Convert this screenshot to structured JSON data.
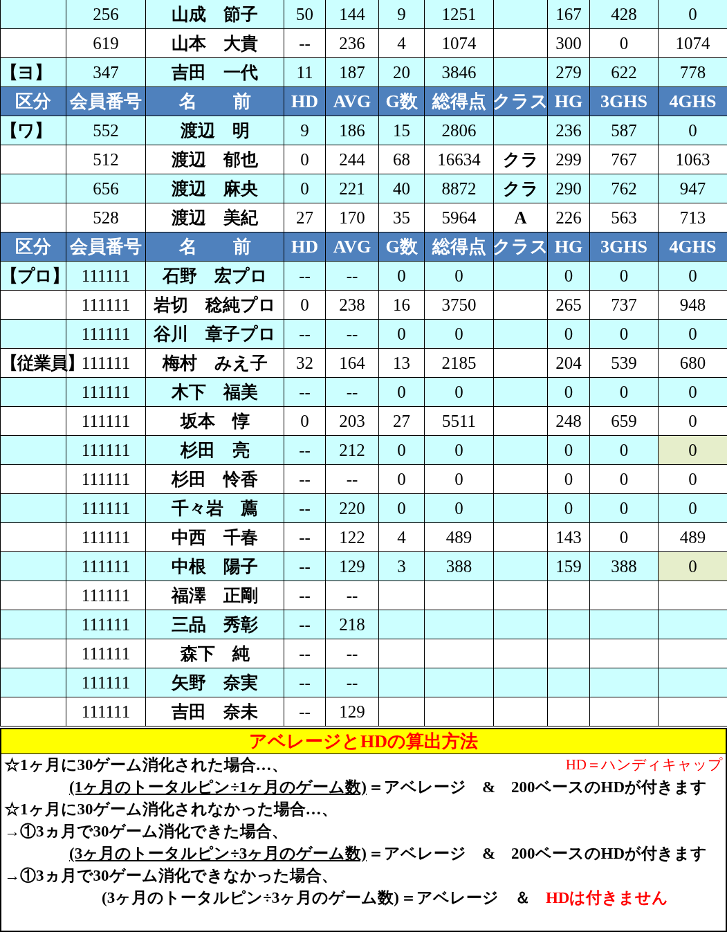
{
  "rows": [
    {
      "kind": "member",
      "shaded": true,
      "member_no": "256",
      "name": "山成　節子",
      "hd": "50",
      "avg": "144",
      "games": "9",
      "total": "1251",
      "hg": "167",
      "ghs3": "428",
      "ghs4": "0",
      "ghs4_flagged": false
    },
    {
      "kind": "member",
      "shaded": false,
      "member_no": "619",
      "name": "山本　大貴",
      "hd": "--",
      "avg": "236",
      "games": "4",
      "total": "1074",
      "hg": "300",
      "ghs3": "0",
      "ghs4": "1074",
      "ghs4_flagged": false
    },
    {
      "kind": "member",
      "shaded": true,
      "group": "【ヨ】",
      "member_no": "347",
      "name": "吉田　一代",
      "hd": "11",
      "avg": "187",
      "games": "20",
      "total": "3846",
      "hg": "279",
      "ghs3": "622",
      "ghs4": "778",
      "ghs4_flagged": false
    },
    {
      "kind": "header",
      "cells": [
        "区分",
        "会員番号",
        "名　　前",
        "HD",
        "AVG",
        "G数",
        "総得点",
        "クラス",
        "HG",
        "3GHS",
        "4GHS"
      ]
    },
    {
      "kind": "member",
      "shaded": true,
      "group": "【ワ】",
      "member_no": "552",
      "name": "渡辺　明",
      "hd": "9",
      "avg": "186",
      "games": "15",
      "total": "2806",
      "hg": "236",
      "ghs3": "587",
      "ghs4": "0",
      "ghs4_flagged": false
    },
    {
      "kind": "member",
      "shaded": false,
      "member_no": "512",
      "name": "渡辺　郁也",
      "hd": "0",
      "avg": "244",
      "games": "68",
      "total": "16634",
      "class": "クラ",
      "hg": "299",
      "ghs3": "767",
      "ghs4": "1063",
      "ghs4_flagged": false
    },
    {
      "kind": "member",
      "shaded": true,
      "member_no": "656",
      "name": "渡辺　麻央",
      "hd": "0",
      "avg": "221",
      "games": "40",
      "total": "8872",
      "class": "クラ",
      "hg": "290",
      "ghs3": "762",
      "ghs4": "947",
      "ghs4_flagged": false
    },
    {
      "kind": "member",
      "shaded": false,
      "member_no": "528",
      "name": "渡辺　美紀",
      "hd": "27",
      "avg": "170",
      "games": "35",
      "total": "5964",
      "class": "A",
      "hg": "226",
      "ghs3": "563",
      "ghs4": "713",
      "ghs4_flagged": false
    },
    {
      "kind": "header",
      "cells": [
        "区分",
        "会員番号",
        "名　　前",
        "HD",
        "AVG",
        "G数",
        "総得点",
        "クラス",
        "HG",
        "3GHS",
        "4GHS"
      ]
    },
    {
      "kind": "member",
      "shaded": true,
      "group": "【プロ】",
      "member_no": "111111",
      "name": "石野　宏プロ",
      "hd": "--",
      "avg": "--",
      "games": "0",
      "total": "0",
      "hg": "0",
      "ghs3": "0",
      "ghs4": "0",
      "ghs4_flagged": false
    },
    {
      "kind": "member",
      "shaded": false,
      "member_no": "111111",
      "name": "岩切　稔純プロ",
      "hd": "0",
      "avg": "238",
      "games": "16",
      "total": "3750",
      "hg": "265",
      "ghs3": "737",
      "ghs4": "948",
      "ghs4_flagged": false
    },
    {
      "kind": "member",
      "shaded": true,
      "member_no": "111111",
      "name": "谷川　章子プロ",
      "hd": "--",
      "avg": "--",
      "games": "0",
      "total": "0",
      "hg": "0",
      "ghs3": "0",
      "ghs4": "0",
      "ghs4_flagged": false
    },
    {
      "kind": "member",
      "shaded": false,
      "group": "【従業員】",
      "member_no": "111111",
      "name": "梅村　みえ子",
      "hd": "32",
      "avg": "164",
      "games": "13",
      "total": "2185",
      "hg": "204",
      "ghs3": "539",
      "ghs4": "680",
      "ghs4_flagged": false
    },
    {
      "kind": "member",
      "shaded": true,
      "member_no": "111111",
      "name": "木下　福美",
      "hd": "--",
      "avg": "--",
      "games": "0",
      "total": "0",
      "hg": "0",
      "ghs3": "0",
      "ghs4": "0",
      "ghs4_flagged": false
    },
    {
      "kind": "member",
      "shaded": false,
      "member_no": "111111",
      "name": "坂本　惇",
      "hd": "0",
      "avg": "203",
      "games": "27",
      "total": "5511",
      "hg": "248",
      "ghs3": "659",
      "ghs4": "0",
      "ghs4_flagged": false
    },
    {
      "kind": "member",
      "shaded": true,
      "member_no": "111111",
      "name": "杉田　亮",
      "hd": "--",
      "avg": "212",
      "games": "0",
      "total": "0",
      "hg": "0",
      "ghs3": "0",
      "ghs4": "0",
      "ghs4_flagged": true
    },
    {
      "kind": "member",
      "shaded": false,
      "member_no": "111111",
      "name": "杉田　怜香",
      "hd": "--",
      "avg": "--",
      "games": "0",
      "total": "0",
      "hg": "0",
      "ghs3": "0",
      "ghs4": "0",
      "ghs4_flagged": false
    },
    {
      "kind": "member",
      "shaded": true,
      "member_no": "111111",
      "name": "千々岩　薦",
      "hd": "--",
      "avg": "220",
      "games": "0",
      "total": "0",
      "hg": "0",
      "ghs3": "0",
      "ghs4": "0",
      "ghs4_flagged": false
    },
    {
      "kind": "member",
      "shaded": false,
      "member_no": "111111",
      "name": "中西　千春",
      "hd": "--",
      "avg": "122",
      "games": "4",
      "total": "489",
      "hg": "143",
      "ghs3": "0",
      "ghs4": "489",
      "ghs4_flagged": false
    },
    {
      "kind": "member",
      "shaded": true,
      "member_no": "111111",
      "name": "中根　陽子",
      "hd": "--",
      "avg": "129",
      "games": "3",
      "total": "388",
      "hg": "159",
      "ghs3": "388",
      "ghs4": "0",
      "ghs4_flagged": true
    },
    {
      "kind": "member",
      "shaded": false,
      "member_no": "111111",
      "name": "福澤　正剛",
      "hd": "--",
      "avg": "--"
    },
    {
      "kind": "member",
      "shaded": true,
      "member_no": "111111",
      "name": "三品　秀彰",
      "hd": "--",
      "avg": "218"
    },
    {
      "kind": "member",
      "shaded": false,
      "member_no": "111111",
      "name": "森下　純",
      "hd": "--",
      "avg": "--"
    },
    {
      "kind": "member",
      "shaded": true,
      "member_no": "111111",
      "name": "矢野　奈実",
      "hd": "--",
      "avg": "--"
    },
    {
      "kind": "member",
      "shaded": false,
      "member_no": "111111",
      "name": "吉田　奈未",
      "hd": "--",
      "avg": "129"
    }
  ],
  "note": {
    "title": "アベレージとHDの算出方法",
    "aside": "HD＝ハンディキャップ",
    "lines": [
      {
        "kind": "heading",
        "text": "☆1ヶ月に30ゲーム消化された場合…、"
      },
      {
        "kind": "formula",
        "formula": "(1ヶ月のトータルピン÷1ヶ月のゲーム数)",
        "underlined": true,
        "result": "＝アベレージ　&　200ベースのHDが付きます"
      },
      {
        "kind": "heading",
        "text": "☆1ヶ月に30ゲーム消化されなかった場合…、"
      },
      {
        "kind": "heading",
        "text": "→①3ヵ月で30ゲーム消化できた場合、"
      },
      {
        "kind": "formula",
        "formula": "(3ヶ月のトータルピン÷3ヶ月のゲーム数)",
        "underlined": true,
        "result": "＝アベレージ　&　200ベースのHDが付きます"
      },
      {
        "kind": "heading",
        "text": "→①3ヵ月で30ゲーム消化できなかった場合、"
      },
      {
        "kind": "formula_wide",
        "formula": "(3ヶ月のトータルピン÷3ヶ月のゲーム数)",
        "underlined": false,
        "result": "＝アベレージ　＆",
        "warning": "HDは付きません"
      }
    ]
  }
}
